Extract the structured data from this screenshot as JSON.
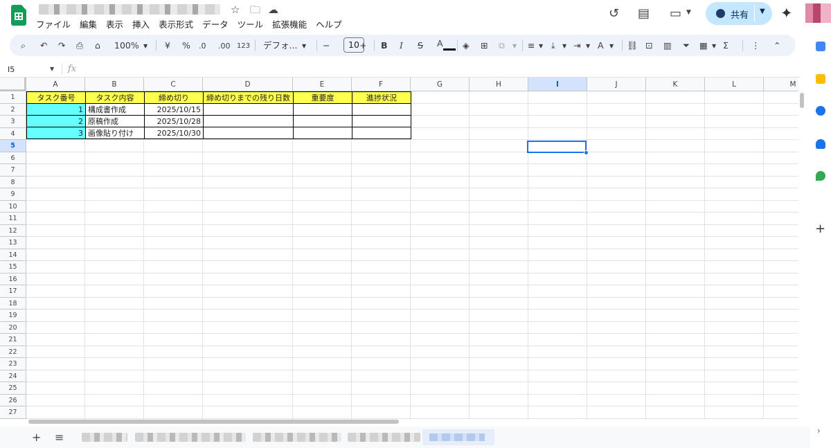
{
  "menu": [
    "ファイル",
    "編集",
    "表示",
    "挿入",
    "表示形式",
    "データ",
    "ツール",
    "拡張機能",
    "ヘルプ"
  ],
  "share_label": "共有",
  "toolbar": {
    "zoom": "100%",
    "currency": "¥",
    "percent": "%",
    "dec_decrease": ".0",
    "dec_increase": ".00",
    "number_format": "123",
    "font": "デフォ...",
    "font_size": "10"
  },
  "name_box": "I5",
  "fx_label": "fx",
  "columns": [
    "A",
    "B",
    "C",
    "D",
    "E",
    "F",
    "G",
    "H",
    "I",
    "J",
    "K",
    "L",
    "M"
  ],
  "active_column": "I",
  "active_row": "5",
  "row_numbers": [
    "1",
    "2",
    "3",
    "4",
    "5",
    "6",
    "7",
    "8",
    "9",
    "10",
    "11",
    "12",
    "13",
    "14",
    "15",
    "16",
    "17",
    "18",
    "19",
    "20",
    "21",
    "22",
    "23",
    "24",
    "25",
    "26",
    "27"
  ],
  "table": {
    "headers": [
      "タスク番号",
      "タスク内容",
      "締め切り",
      "締め切りまでの残り日数",
      "重要度",
      "進捗状況"
    ],
    "rows": [
      {
        "no": "1",
        "task": "構成書作成",
        "deadline": "2025/10/15"
      },
      {
        "no": "2",
        "task": "原稿作成",
        "deadline": "2025/10/28"
      },
      {
        "no": "3",
        "task": "画像貼り付け",
        "deadline": "2025/10/30"
      }
    ]
  },
  "colors": {
    "header_fill": "#ffff4d",
    "number_fill": "#66ffff",
    "share_button": "#c2e7ff",
    "selection": "#1a73e8"
  }
}
